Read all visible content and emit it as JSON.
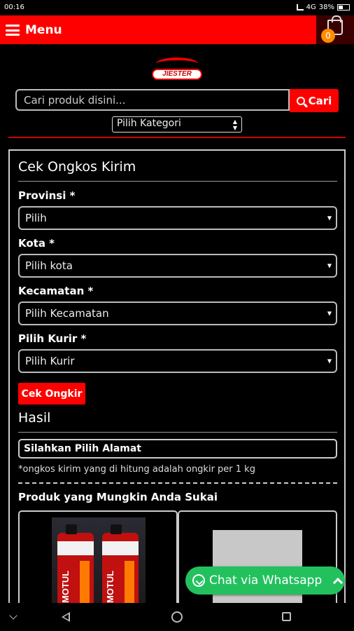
{
  "status_bar": {
    "time": "00:16",
    "network": "4G",
    "battery": "38%"
  },
  "header": {
    "menu_label": "Menu",
    "cart_count": "0"
  },
  "logo": {
    "text": "JIESTER"
  },
  "search": {
    "placeholder": "Cari produk disini...",
    "button_label": "Cari",
    "category_default": "Pilih Kategori"
  },
  "shipping": {
    "title": "Cek Ongkos Kirim",
    "province_label": "Provinsi *",
    "province_value": "Pilih",
    "city_label": "Kota *",
    "city_value": "Pilih kota",
    "district_label": "Kecamatan *",
    "district_value": "Pilih Kecamatan",
    "courier_label": "Pilih Kurir *",
    "courier_value": "Pilih Kurir",
    "check_button": "Cek Ongkir",
    "result_title": "Hasil",
    "result_value": "Silahkan Pilih Alamat",
    "note": "*ongkos kirim yang di hitung adalah ongkir per 1 kg"
  },
  "recommendations": {
    "title": "Produk yang Mungkin Anda Sukai",
    "brand_on_product": "MOTUL"
  },
  "whatsapp": {
    "label": "Chat via Whatsapp"
  },
  "colors": {
    "brand_red": "#ff0000",
    "whatsapp_green": "#22c15e",
    "cart_badge": "#ff8c00"
  }
}
